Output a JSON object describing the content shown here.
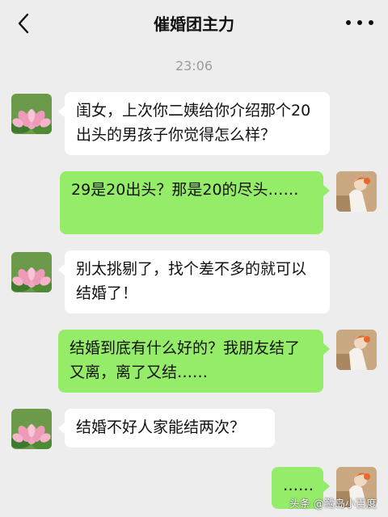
{
  "header": {
    "title": "催婚团主力",
    "back_icon": "chevron-left-icon",
    "more_icon": "more-dots-icon"
  },
  "timestamp": "23:06",
  "messages": [
    {
      "side": "in",
      "text": "闺女，上次你二姨给你介绍那个20出头的男孩子你觉得怎么样？"
    },
    {
      "side": "out",
      "text": "29是20出头？那是20的尽头……"
    },
    {
      "side": "in",
      "text": "别太挑剔了，找个差不多的就可以结婚了！"
    },
    {
      "side": "out",
      "text": "结婚到底有什么好的？我朋友结了又离，离了又结……"
    },
    {
      "side": "in",
      "text": "结婚不好人家能结两次？"
    },
    {
      "side": "out",
      "text": "……"
    }
  ],
  "watermark": "头条 @鹭岛小百度",
  "colors": {
    "background": "#ededed",
    "incoming_bubble": "#ffffff",
    "outgoing_bubble": "#95ec69"
  }
}
